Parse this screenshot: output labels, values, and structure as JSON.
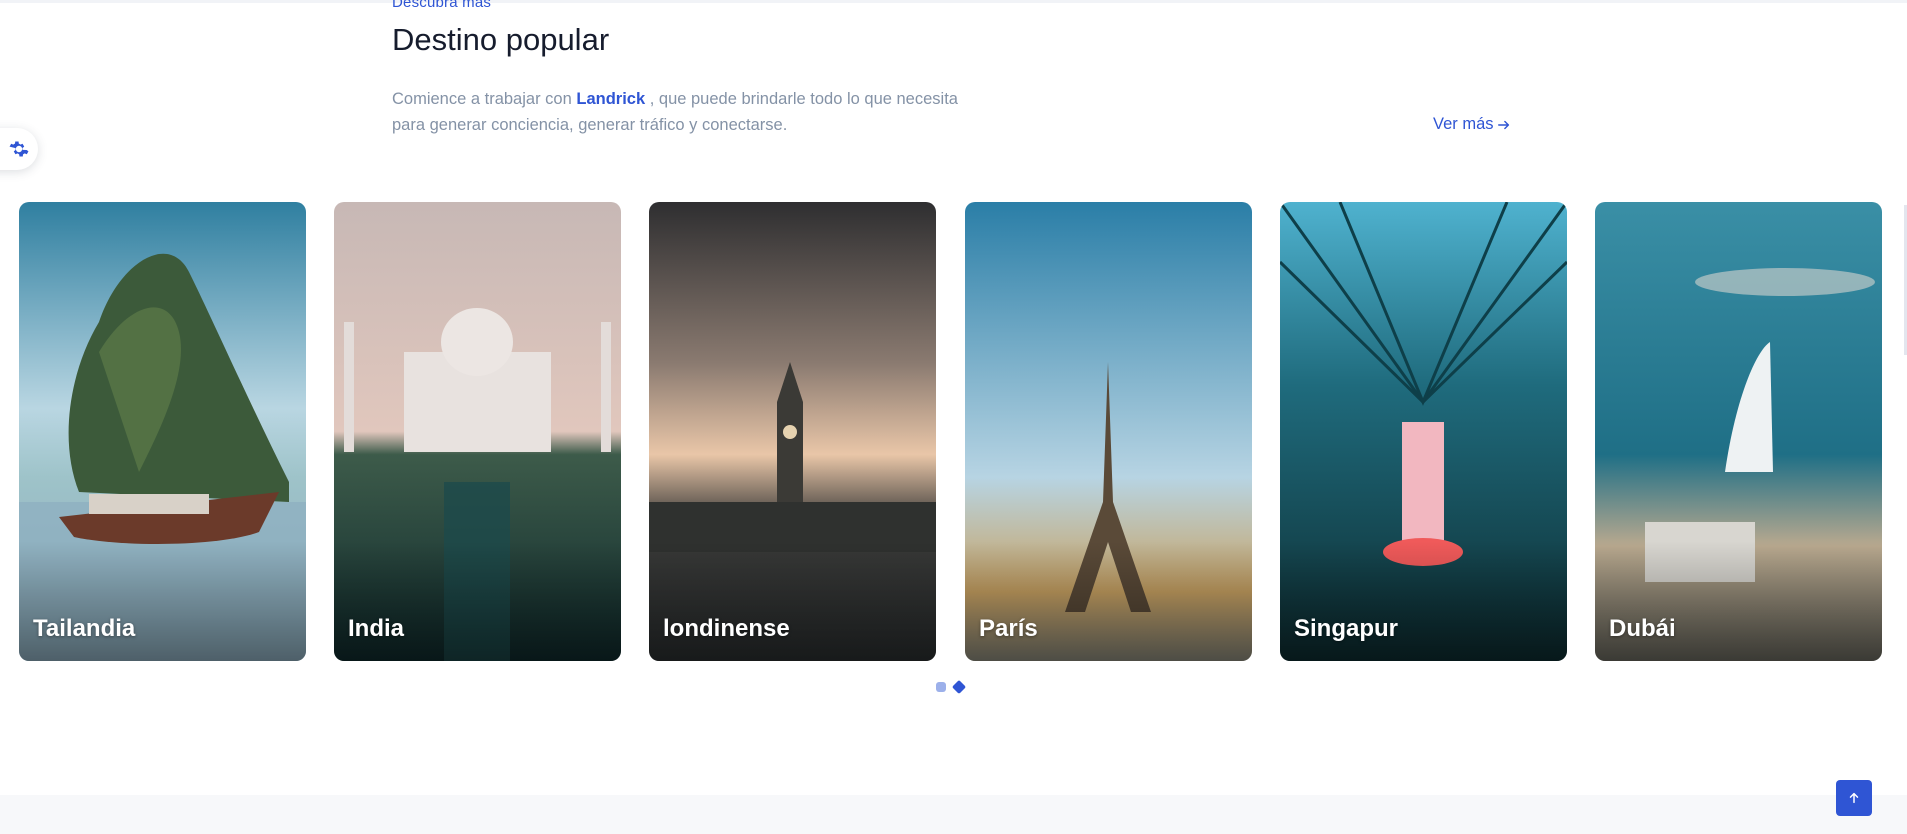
{
  "section": {
    "kicker": "Descubra más",
    "title": "Destino popular",
    "desc_before": "Comience a trabajar con ",
    "desc_brand": "Landrick",
    "desc_after": " , que puede brindarle todo lo que necesita para generar conciencia, generar tráfico y conectarse.",
    "more_label": "Ver más"
  },
  "destinations": [
    {
      "name": "Tailandia"
    },
    {
      "name": "India"
    },
    {
      "name": "londinense"
    },
    {
      "name": "París"
    },
    {
      "name": "Singapur"
    },
    {
      "name": "Dubái"
    }
  ],
  "carousel": {
    "pages": 2,
    "active": 2
  },
  "icons": {
    "settings": "gear-icon",
    "more": "arrow-right-icon",
    "back_to_top": "arrow-up-icon"
  },
  "colors": {
    "accent": "#2f55d4",
    "muted": "#8492a6",
    "heading": "#161c2d"
  }
}
